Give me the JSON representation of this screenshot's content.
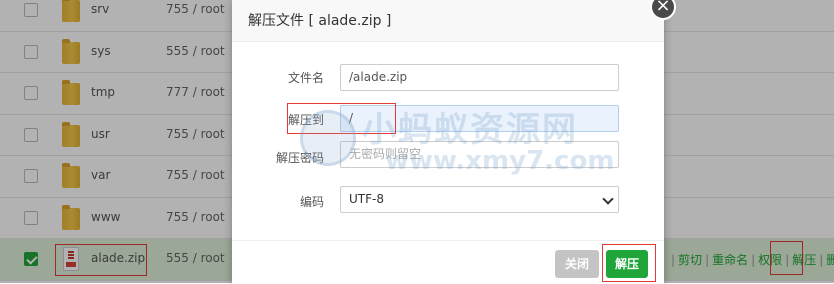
{
  "files": [
    {
      "name": "srv",
      "perm": "755 / root",
      "type": "folder"
    },
    {
      "name": "sys",
      "perm": "555 / root",
      "type": "folder"
    },
    {
      "name": "tmp",
      "perm": "777 / root",
      "type": "folder"
    },
    {
      "name": "usr",
      "perm": "755 / root",
      "type": "folder"
    },
    {
      "name": "var",
      "perm": "755 / root",
      "type": "folder"
    },
    {
      "name": "www",
      "perm": "755 / root",
      "type": "folder"
    },
    {
      "name": "alade.zip",
      "perm": "555 / root",
      "type": "zip",
      "selected": true
    }
  ],
  "row_ops": [
    "剪切",
    "重命名",
    "权限",
    "解压",
    "删除"
  ],
  "dialog": {
    "title": "解压文件 [ alade.zip ]",
    "close_icon": "×",
    "fields": {
      "filename_label": "文件名",
      "filename_value": "/alade.zip",
      "dest_label": "解压到",
      "dest_value": "/",
      "password_label": "解压密码",
      "password_placeholder": "无密码则留空",
      "encoding_label": "编码",
      "encoding_value": "UTF-8"
    },
    "buttons": {
      "close": "关闭",
      "extract": "解压"
    }
  },
  "watermark": {
    "text": "小蚂蚁资源网",
    "url": "www.xmy7.com"
  },
  "colors": {
    "accent": "#20a53a",
    "highlight_box": "#e53935",
    "selected_row": "#dff0d8"
  }
}
